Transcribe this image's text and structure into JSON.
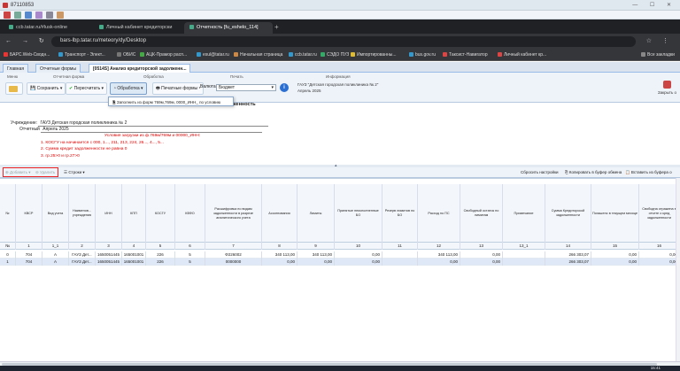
{
  "window": {
    "title": "87110853"
  },
  "browser": {
    "tabs": [
      {
        "label": "ccb.tatar.ru/#lusk-online",
        "active": false
      },
      {
        "label": "Личный кабинет кредиторски",
        "active": false
      },
      {
        "label": "Отчетность [fu_eshelo_114]",
        "active": true
      }
    ],
    "url": "bars-lbp.tatar.ru/meteory/dy/Desktop",
    "bookmarks": [
      "БАРС.Web-Сводн...",
      "Транспорт - Элект...",
      "ОБИС",
      "АЦК-Прамор расп...",
      "esul@tatar.ru",
      "Начальная страница",
      "ccb.tatar.ru",
      "СЭДО ПУЗ",
      "Импортированны...",
      "bus.gov.ru",
      "Таксист-Навигатор",
      "Личный кабинет кр...",
      "Все закладки"
    ]
  },
  "app": {
    "tabs": [
      {
        "label": "Главная",
        "active": false
      },
      {
        "label": "Отчетные формы",
        "active": false
      },
      {
        "label": "[0514S] Анализ кредиторской задолженн...",
        "active": true
      }
    ],
    "ribbon": {
      "groups": {
        "menu": "Меню",
        "report_form": "Отчетная форма",
        "processing": "Обработка",
        "print": "Печать",
        "info": "Информация"
      },
      "save": "Сохранить",
      "recalc": "Пересчитать",
      "process": "Обработка",
      "print_forms": "Печатные формы",
      "currency_label": "Валюта",
      "currency_value": "Бюджет",
      "info_org": "ГАУЗ \"Детская городская поликлиника № 2\"",
      "info_period": "Апрель 2025",
      "close": "Закрыть о"
    },
    "dropdown_item": "Заполнить из форм 769м,769м, 0000_ИНН_ по условию",
    "doc_title": "олженность",
    "form": {
      "institution_label": "Учреждение:",
      "institution_value": "ГАУЗ Детская городская поликлиника № 2",
      "period_label": "Отчетный",
      "period_value": "Апрель 2025"
    },
    "errors": [
      "Условия загрузки из ф.769м/769м и 00000_ИНН:",
      "1. КОСГУ на начинается с 000, 1..., 211, 213, 224, 26..., 4..., 5...",
      "2. Сумма кредит задолженности не равна 0",
      "3. гр.25>0 и гр.27>0"
    ],
    "grid_toolbar": {
      "add": "Добавить",
      "delete": "Удалить",
      "rows": "Строки",
      "reset": "Сбросить настройки",
      "copy": "Копировать в буфер обмена",
      "paste": "Вставить из буфера о"
    },
    "grid": {
      "headers": [
        "№",
        "КВСР",
        "Вид учета",
        "Наименов... учреждения",
        "ИНН",
        "КПП",
        "КОСГУ",
        "КВФО",
        "Расшифровка по видам задолженности в разрезе аналитического учета",
        "Ассигнования",
        "Лимиты",
        "Принятые неисполненные БО",
        "Резерв лимитов по БО",
        "Расход по ПС",
        "Свободный остаток по лимитам",
        "Примечание",
        "Сумма Кредиторской задолженности",
        "Погашено в текущем месяце",
        "Свободна отражена в отчете о кред задолженности"
      ],
      "col_numbers": [
        "№",
        "1",
        "1_1",
        "2",
        "3",
        "4",
        "5",
        "6",
        "7",
        "8",
        "9",
        "10",
        "11",
        "12",
        "13",
        "13_1",
        "14",
        "15",
        "16"
      ],
      "rows": [
        [
          "0",
          "704",
          "А",
          "ГАУЗ Дет...",
          "1650051445",
          "165001001",
          "226",
          "5",
          "Ф226002",
          "340 113,00",
          "340 113,00",
          "0,00",
          "",
          "340 113,00",
          "0,00",
          "",
          "266 303,07",
          "0,00",
          "0,00"
        ],
        [
          "1",
          "704",
          "А",
          "ГАУЗ Дет...",
          "1650051445",
          "165001001",
          "226",
          "5",
          "0000000",
          "0,00",
          "0,00",
          "0,00",
          "",
          "0,00",
          "0,00",
          "",
          "266 303,07",
          "0,00",
          "0,00"
        ]
      ]
    }
  },
  "taskbar": {
    "time": "15:41"
  }
}
